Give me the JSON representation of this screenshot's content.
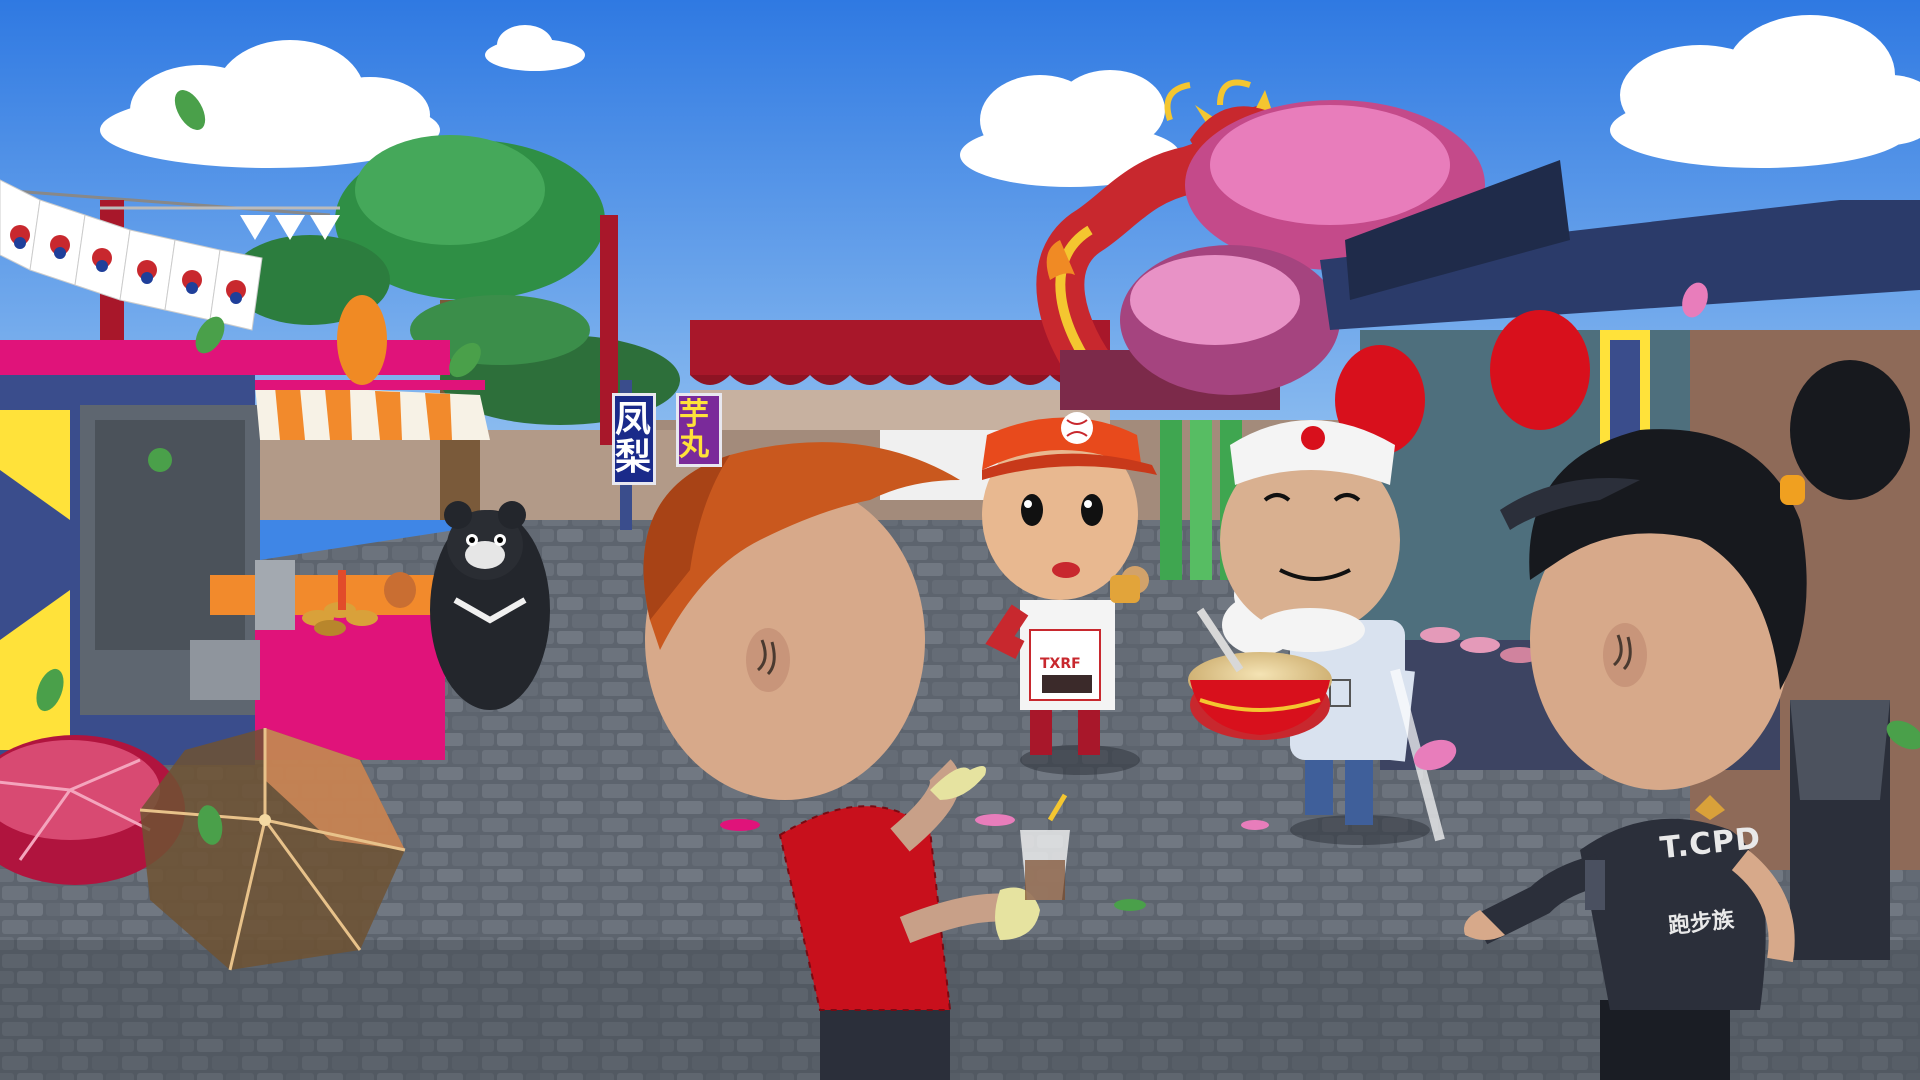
{
  "scene": {
    "colors": {
      "sky_top": "#2f79e2",
      "sky_bottom": "#9cc8f2",
      "pavement": "#5d646e",
      "pavement_dark": "#3e444c",
      "awning_red": "#a8172a",
      "stall_pink": "#e0137a",
      "dragon_red": "#c8282e"
    }
  },
  "signs": {
    "pineapple": "凤梨",
    "taro": "芋丸"
  },
  "characters": {
    "runner_shirt_brand": "T.CPD",
    "runner_shirt_sub": "跑步族"
  }
}
